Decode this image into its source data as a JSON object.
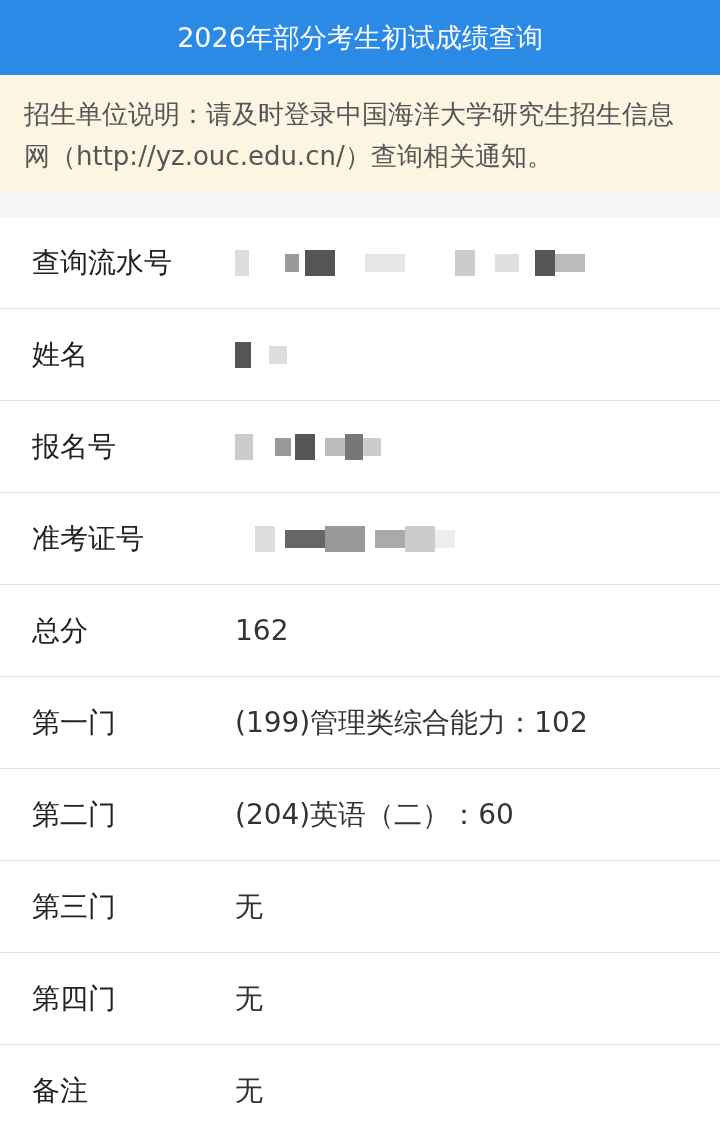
{
  "header": {
    "title": "2026年部分考生初试成绩查询"
  },
  "notice": "招生单位说明：请及时登录中国海洋大学研究生招生信息网（http://yz.ouc.edu.cn/）查询相关通知。",
  "rows": [
    {
      "label": "查询流水号",
      "kind": "redacted"
    },
    {
      "label": "姓名",
      "kind": "redacted"
    },
    {
      "label": "报名号",
      "kind": "redacted"
    },
    {
      "label": "准考证号",
      "kind": "redacted"
    },
    {
      "label": "总分",
      "kind": "text",
      "value": "162"
    },
    {
      "label": "第一门",
      "kind": "text",
      "value": "(199)管理类综合能力：102"
    },
    {
      "label": "第二门",
      "kind": "text",
      "value": "(204)英语（二）：60"
    },
    {
      "label": "第三门",
      "kind": "text",
      "value": "无"
    },
    {
      "label": "第四门",
      "kind": "text",
      "value": "无"
    },
    {
      "label": "备注",
      "kind": "text",
      "value": "无"
    }
  ]
}
